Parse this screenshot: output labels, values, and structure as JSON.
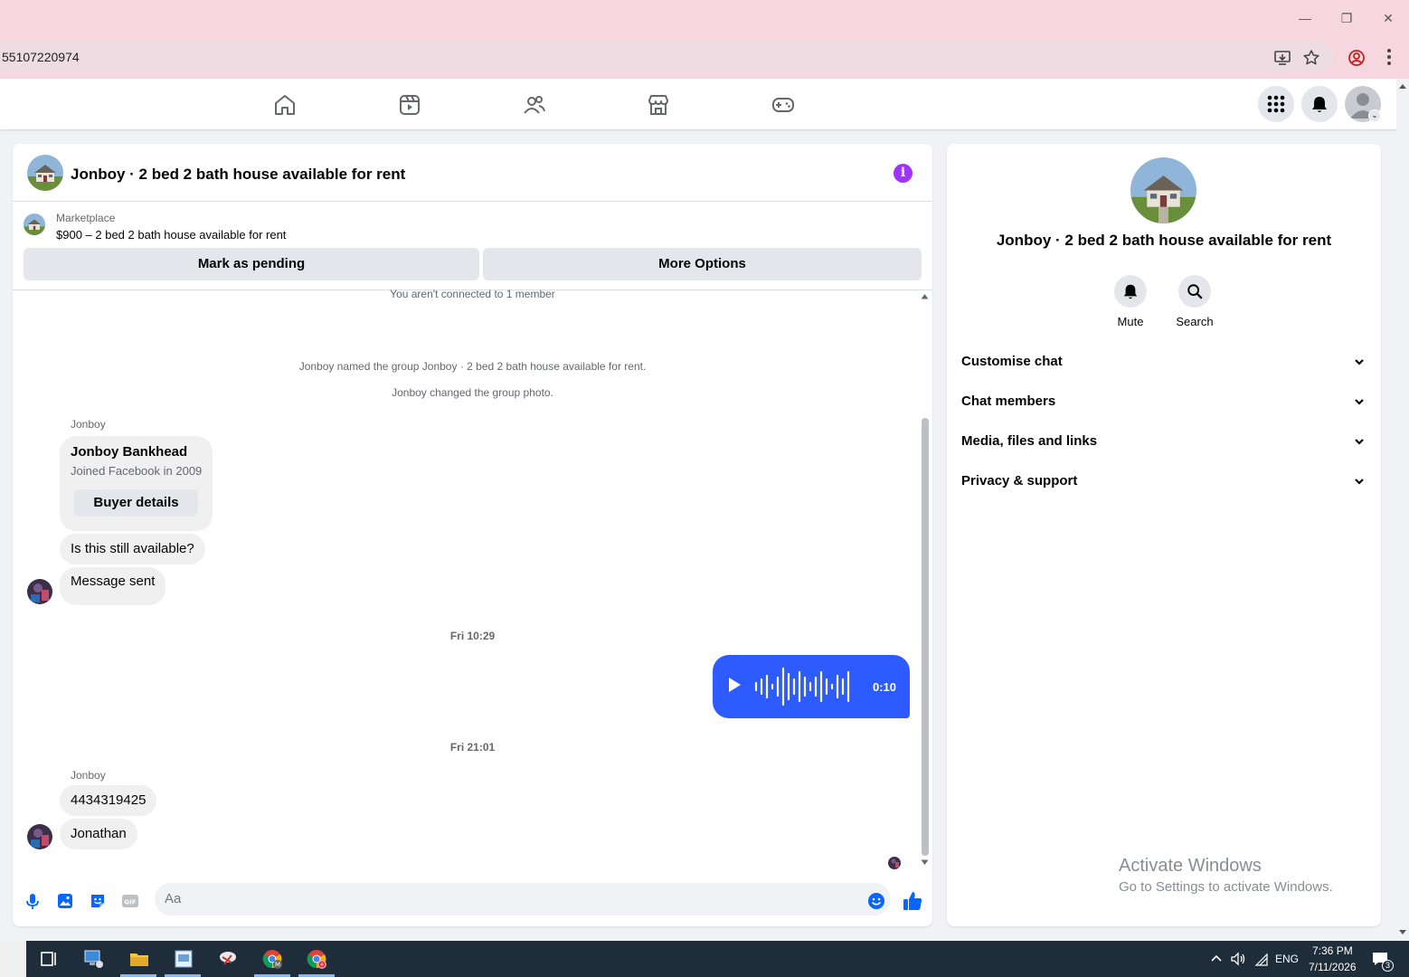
{
  "browser": {
    "url": "55107220974",
    "minimize": "—",
    "restore": "❐",
    "close": "✕"
  },
  "chat": {
    "title": "Jonboy · 2 bed 2 bath house available for rent",
    "marketplace_label": "Marketplace",
    "marketplace_item": "$900 – 2 bed 2 bath house available for rent",
    "mark_pending": "Mark as pending",
    "more_options": "More Options",
    "not_connected": "You aren't connected to 1 member",
    "system_1": "Jonboy named the group Jonboy · 2 bed 2 bath house available for rent.",
    "system_2": "Jonboy changed the group photo.",
    "sender_1": "Jonboy",
    "card_name": "Jonboy Bankhead",
    "card_sub": "Joined Facebook in 2009",
    "card_button": "Buyer details",
    "msg_1": "Is this still available?",
    "msg_2": "Message sent",
    "timestamp_1": "Fri 10:29",
    "voice_duration": "0:10",
    "timestamp_2": "Fri 21:01",
    "sender_2": "Jonboy",
    "msg_3": "4434319425",
    "msg_4": "Jonathan",
    "composer_placeholder": "Aa"
  },
  "side": {
    "title": "Jonboy · 2 bed 2 bath house available for rent",
    "mute": "Mute",
    "search": "Search",
    "sections": [
      "Customise chat",
      "Chat members",
      "Media, files and links",
      "Privacy & support"
    ]
  },
  "watermark": {
    "line1": "Activate Windows",
    "line2": "Go to Settings to activate Windows."
  },
  "taskbar": {
    "lang": "ENG",
    "time": "7:36 PM",
    "date": "7/11/2026",
    "notif_count": "3",
    "chrome_badge_1": "M"
  },
  "colors": {
    "accent": "#2e5bff",
    "info": "#a033ff",
    "like": "#0866ff"
  }
}
